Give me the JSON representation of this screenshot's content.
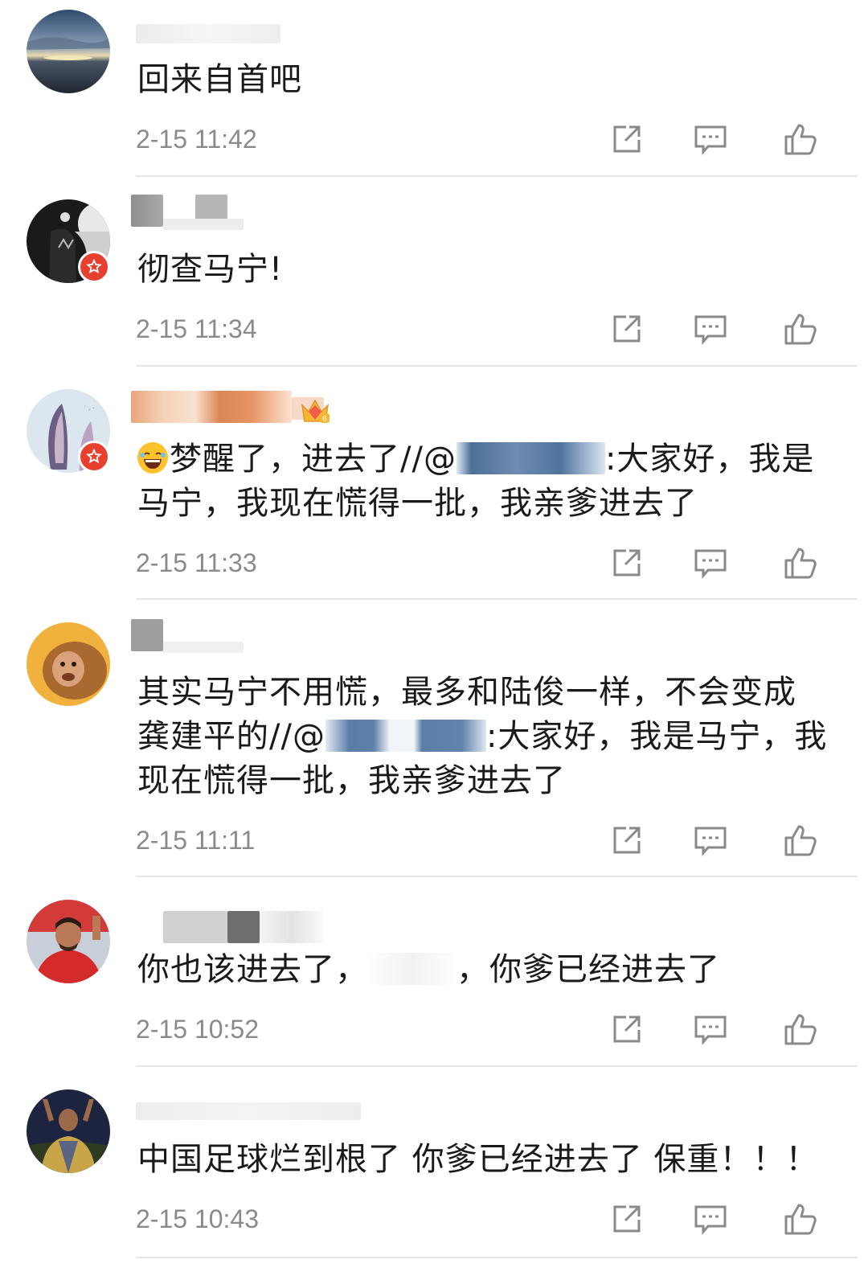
{
  "comments": [
    {
      "text": "回来自首吧",
      "time": "2-15 11:42"
    },
    {
      "text": "彻查马宁!",
      "time": "2-15 11:34"
    },
    {
      "text_a": "梦醒了，进去了//@",
      "text_b": ":大家好，我是马宁，我现在慌得一批，我亲爹进去了",
      "time": "2-15 11:33"
    },
    {
      "text_a": "其实马宁不用慌，最多和陆俊一样，不会变成龚建平的//@",
      "text_b": ":大家好，我是马宁，我现在慌得一批，我亲爹进去了",
      "time": "2-15 11:11"
    },
    {
      "text_a": "你也该进去了，",
      "text_b": "，你爹已经进去了",
      "time": "2-15 10:52"
    },
    {
      "text": "中国足球烂到根了 你爹已经进去了  保重！！！",
      "time": "2-15 10:43"
    }
  ],
  "icons": [
    "share-icon",
    "reply-icon",
    "like-icon",
    "crown-badge-icon",
    "verified-badge-icon",
    "laughing-emoji-icon"
  ],
  "colors": {
    "text": "#1a1a1a",
    "time": "#8a8a8a",
    "icon": "#8a8a8a",
    "divider": "#e6e6e6",
    "badge": "#e8402f"
  }
}
